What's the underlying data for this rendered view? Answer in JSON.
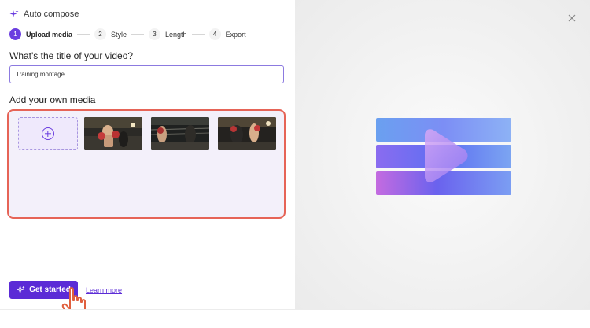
{
  "header": {
    "title": "Auto compose",
    "icon": "sparkle-icon"
  },
  "steps": [
    {
      "number": "1",
      "label": "Upload media",
      "active": true
    },
    {
      "number": "2",
      "label": "Style",
      "active": false
    },
    {
      "number": "3",
      "label": "Length",
      "active": false
    },
    {
      "number": "4",
      "label": "Export",
      "active": false
    }
  ],
  "title_section": {
    "question": "What's the title of your video?",
    "input_value": "Training montage"
  },
  "media_section": {
    "heading": "Add your own media",
    "add_icon": "plus-circle-icon",
    "thumbnails": [
      "boxing-clip-1",
      "boxing-clip-2",
      "boxing-clip-3"
    ]
  },
  "footer": {
    "get_started_label": "Get started",
    "learn_more_label": "Learn more"
  },
  "colors": {
    "accent": "#5b2bd6",
    "highlight_border": "#e66457",
    "media_bg": "#f3f0fa"
  },
  "close_icon": "close-icon"
}
